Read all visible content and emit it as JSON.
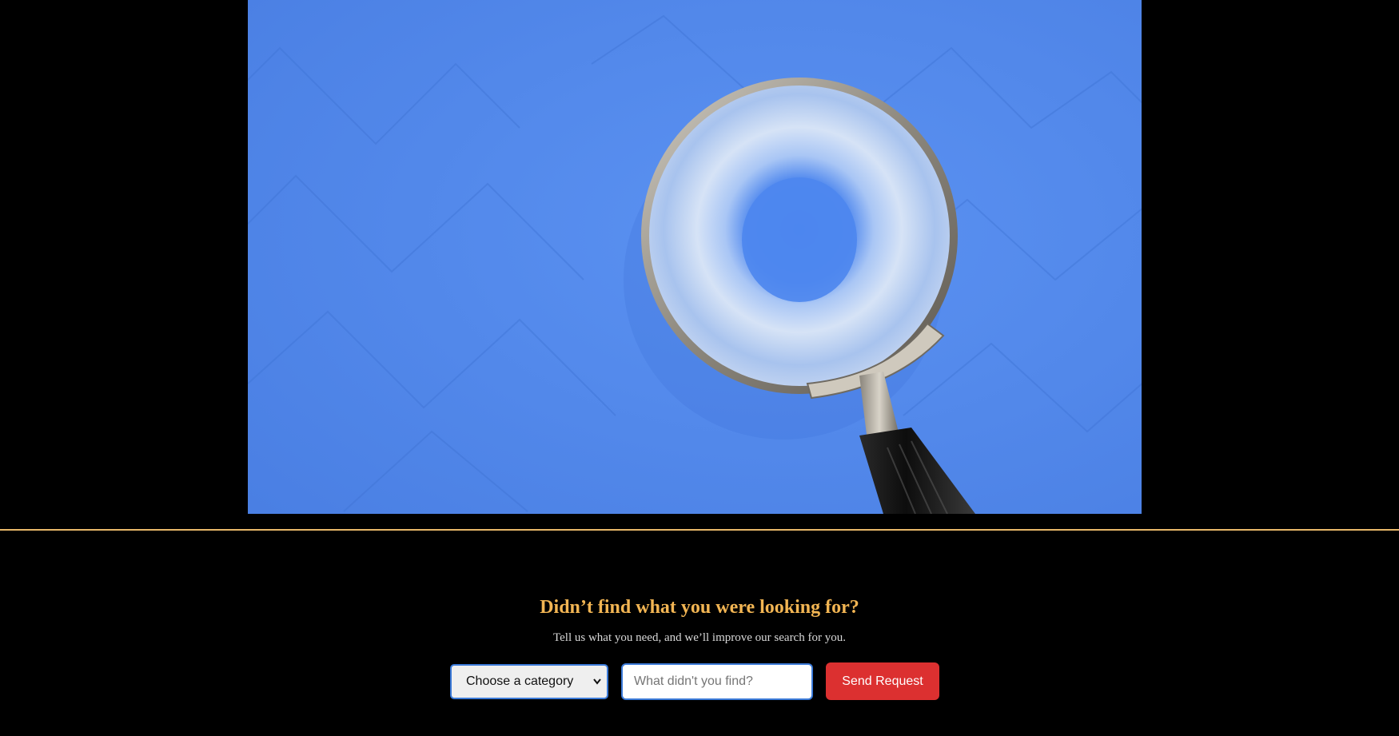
{
  "hero": {
    "image_subject": "magnifying-glass-on-blue-background",
    "background_color": "#4f86ea"
  },
  "divider": {
    "color": "#e8b86a"
  },
  "feedback": {
    "title": "Didn’t find what you were looking for?",
    "subtitle": "Tell us what you need, and we’ll improve our search for you.",
    "category_select": {
      "selected_label": "Choose a category"
    },
    "query_input": {
      "placeholder": "What didn't you find?",
      "value": ""
    },
    "submit_label": "Send Request"
  },
  "colors": {
    "background": "#000000",
    "title": "#f2b553",
    "subtitle": "#d8d8d8",
    "input_border": "#3b7ad8",
    "button": "#dc3030",
    "button_text": "#ffffff"
  }
}
